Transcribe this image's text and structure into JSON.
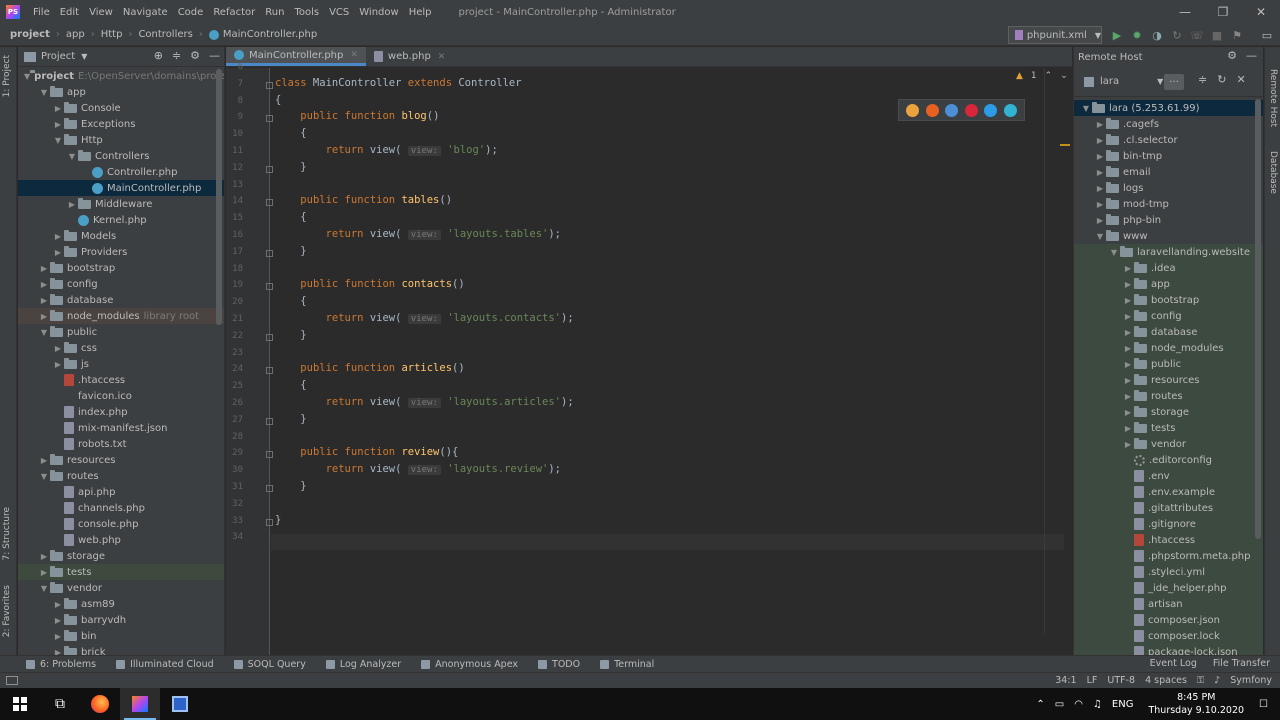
{
  "titlebar": {
    "menu": [
      "File",
      "Edit",
      "View",
      "Navigate",
      "Code",
      "Refactor",
      "Run",
      "Tools",
      "VCS",
      "Window",
      "Help"
    ],
    "window_title": "project - MainController.php - Administrator",
    "logo_text": "PS"
  },
  "navbar": {
    "crumbs": [
      "project",
      "app",
      "Http",
      "Controllers",
      "MainController.php"
    ],
    "run_config": "phpunit.xml"
  },
  "left_stripe": {
    "project_tab": "1: Project",
    "structure_tab": "7: Structure",
    "favorites_tab": "2: Favorites"
  },
  "project_panel": {
    "title": "Project",
    "root_path": "E:\\OpenServer\\domains\\proje",
    "items": [
      {
        "label": "project",
        "indent": 0,
        "type": "folder",
        "open": true,
        "bold": true
      },
      {
        "label": "app",
        "indent": 1,
        "type": "folder",
        "open": true
      },
      {
        "label": "Console",
        "indent": 2,
        "type": "folder",
        "open": false
      },
      {
        "label": "Exceptions",
        "indent": 2,
        "type": "folder",
        "open": false
      },
      {
        "label": "Http",
        "indent": 2,
        "type": "folder",
        "open": true
      },
      {
        "label": "Controllers",
        "indent": 3,
        "type": "folder",
        "open": true
      },
      {
        "label": "Controller.php",
        "indent": 4,
        "type": "php"
      },
      {
        "label": "MainController.php",
        "indent": 4,
        "type": "php",
        "selected": true
      },
      {
        "label": "Middleware",
        "indent": 3,
        "type": "folder",
        "open": false
      },
      {
        "label": "Kernel.php",
        "indent": 3,
        "type": "php"
      },
      {
        "label": "Models",
        "indent": 2,
        "type": "folder",
        "open": false
      },
      {
        "label": "Providers",
        "indent": 2,
        "type": "folder",
        "open": false
      },
      {
        "label": "bootstrap",
        "indent": 1,
        "type": "folder",
        "open": false
      },
      {
        "label": "config",
        "indent": 1,
        "type": "folder",
        "open": false
      },
      {
        "label": "database",
        "indent": 1,
        "type": "folder",
        "open": false
      },
      {
        "label": "node_modules",
        "indent": 1,
        "type": "folder",
        "open": false,
        "libroot": true,
        "note": "library root"
      },
      {
        "label": "public",
        "indent": 1,
        "type": "folder",
        "open": true
      },
      {
        "label": "css",
        "indent": 2,
        "type": "folder",
        "open": false
      },
      {
        "label": "js",
        "indent": 2,
        "type": "folder",
        "open": false
      },
      {
        "label": ".htaccess",
        "indent": 2,
        "type": "ht"
      },
      {
        "label": "favicon.ico",
        "indent": 2,
        "type": "none"
      },
      {
        "label": "index.php",
        "indent": 2,
        "type": "gen"
      },
      {
        "label": "mix-manifest.json",
        "indent": 2,
        "type": "gen"
      },
      {
        "label": "robots.txt",
        "indent": 2,
        "type": "gen"
      },
      {
        "label": "resources",
        "indent": 1,
        "type": "folder",
        "open": false
      },
      {
        "label": "routes",
        "indent": 1,
        "type": "folder",
        "open": true
      },
      {
        "label": "api.php",
        "indent": 2,
        "type": "gen"
      },
      {
        "label": "channels.php",
        "indent": 2,
        "type": "gen"
      },
      {
        "label": "console.php",
        "indent": 2,
        "type": "gen"
      },
      {
        "label": "web.php",
        "indent": 2,
        "type": "gen"
      },
      {
        "label": "storage",
        "indent": 1,
        "type": "folder",
        "open": false
      },
      {
        "label": "tests",
        "indent": 1,
        "type": "folder",
        "open": false,
        "excluded": true
      },
      {
        "label": "vendor",
        "indent": 1,
        "type": "folder",
        "open": true
      },
      {
        "label": "asm89",
        "indent": 2,
        "type": "folder",
        "open": false
      },
      {
        "label": "barryvdh",
        "indent": 2,
        "type": "folder",
        "open": false
      },
      {
        "label": "bin",
        "indent": 2,
        "type": "folder",
        "open": false
      },
      {
        "label": "brick",
        "indent": 2,
        "type": "folder",
        "open": false
      }
    ]
  },
  "editor": {
    "tabs": [
      {
        "label": "MainController.php",
        "active": true
      },
      {
        "label": "web.php",
        "active": false
      }
    ],
    "inspection_count": "1",
    "lines": [
      {
        "n": "6",
        "html": ""
      },
      {
        "n": "7",
        "html": "<span class=\"kw\">class</span> MainController <span class=\"kw\">extends</span> Controller"
      },
      {
        "n": "8",
        "html": "{"
      },
      {
        "n": "9",
        "html": "    <span class=\"kw\">public function</span> <span class=\"fn\">blog</span>()"
      },
      {
        "n": "10",
        "html": "    {"
      },
      {
        "n": "11",
        "html": "        <span class=\"kw\">return</span> view( <span class=\"hint\">view:</span> <span class=\"str\">'blog'</span>);"
      },
      {
        "n": "12",
        "html": "    }"
      },
      {
        "n": "13",
        "html": ""
      },
      {
        "n": "14",
        "html": "    <span class=\"kw\">public function</span> <span class=\"fn\">tables</span>()"
      },
      {
        "n": "15",
        "html": "    {"
      },
      {
        "n": "16",
        "html": "        <span class=\"kw\">return</span> view( <span class=\"hint\">view:</span> <span class=\"str\">'layouts.tables'</span>);"
      },
      {
        "n": "17",
        "html": "    }"
      },
      {
        "n": "18",
        "html": ""
      },
      {
        "n": "19",
        "html": "    <span class=\"kw\">public function</span> <span class=\"fn\">contacts</span>()"
      },
      {
        "n": "20",
        "html": "    {"
      },
      {
        "n": "21",
        "html": "        <span class=\"kw\">return</span> view( <span class=\"hint\">view:</span> <span class=\"str\">'layouts.contacts'</span>);"
      },
      {
        "n": "22",
        "html": "    }"
      },
      {
        "n": "23",
        "html": ""
      },
      {
        "n": "24",
        "html": "    <span class=\"kw\">public function</span> <span class=\"fn\">articles</span>()"
      },
      {
        "n": "25",
        "html": "    {"
      },
      {
        "n": "26",
        "html": "        <span class=\"kw\">return</span> view( <span class=\"hint\">view:</span> <span class=\"str\">'layouts.articles'</span>);"
      },
      {
        "n": "27",
        "html": "    }"
      },
      {
        "n": "28",
        "html": ""
      },
      {
        "n": "29",
        "html": "    <span class=\"kw\">public function</span> <span class=\"fn\">review</span>(){"
      },
      {
        "n": "30",
        "html": "        <span class=\"kw\">return</span> view( <span class=\"hint\">view:</span> <span class=\"str\">'layouts.review'</span>);"
      },
      {
        "n": "31",
        "html": "    }"
      },
      {
        "n": "32",
        "html": ""
      },
      {
        "n": "33",
        "html": "}"
      },
      {
        "n": "34",
        "html": ""
      }
    ],
    "browsers": [
      {
        "name": "chrome-icon",
        "color": "#e8a33d"
      },
      {
        "name": "firefox-icon",
        "color": "#e66020"
      },
      {
        "name": "safari-icon",
        "color": "#4d8fd6"
      },
      {
        "name": "opera-icon",
        "color": "#d8263a"
      },
      {
        "name": "ie-icon",
        "color": "#2d9ce8"
      },
      {
        "name": "edge-icon",
        "color": "#32b3d4"
      }
    ]
  },
  "remote_panel": {
    "title": "Remote Host",
    "server": "lara",
    "dots_label": "...",
    "items": [
      {
        "label": "lara (5.253.61.99)",
        "indent": 0,
        "type": "folder",
        "open": true,
        "selected": true
      },
      {
        "label": ".cagefs",
        "indent": 1,
        "type": "folder",
        "open": false
      },
      {
        "label": ".cl.selector",
        "indent": 1,
        "type": "folder",
        "open": false
      },
      {
        "label": "bin-tmp",
        "indent": 1,
        "type": "folder",
        "open": false
      },
      {
        "label": "email",
        "indent": 1,
        "type": "folder",
        "open": false
      },
      {
        "label": "logs",
        "indent": 1,
        "type": "folder",
        "open": false
      },
      {
        "label": "mod-tmp",
        "indent": 1,
        "type": "folder",
        "open": false
      },
      {
        "label": "php-bin",
        "indent": 1,
        "type": "folder",
        "open": false
      },
      {
        "label": "www",
        "indent": 1,
        "type": "folder",
        "open": true
      },
      {
        "label": "laravellanding.website",
        "indent": 2,
        "type": "folder",
        "open": true,
        "excluded": true
      },
      {
        "label": ".idea",
        "indent": 3,
        "type": "folder",
        "open": false,
        "excluded": true
      },
      {
        "label": "app",
        "indent": 3,
        "type": "folder",
        "open": false,
        "excluded": true
      },
      {
        "label": "bootstrap",
        "indent": 3,
        "type": "folder",
        "open": false,
        "excluded": true
      },
      {
        "label": "config",
        "indent": 3,
        "type": "folder",
        "open": false,
        "excluded": true
      },
      {
        "label": "database",
        "indent": 3,
        "type": "folder",
        "open": false,
        "excluded": true
      },
      {
        "label": "node_modules",
        "indent": 3,
        "type": "folder",
        "open": false,
        "excluded": true
      },
      {
        "label": "public",
        "indent": 3,
        "type": "folder",
        "open": false,
        "excluded": true
      },
      {
        "label": "resources",
        "indent": 3,
        "type": "folder",
        "open": false,
        "excluded": true
      },
      {
        "label": "routes",
        "indent": 3,
        "type": "folder",
        "open": false,
        "excluded": true
      },
      {
        "label": "storage",
        "indent": 3,
        "type": "folder",
        "open": false,
        "excluded": true
      },
      {
        "label": "tests",
        "indent": 3,
        "type": "folder",
        "open": false,
        "excluded": true
      },
      {
        "label": "vendor",
        "indent": 3,
        "type": "folder",
        "open": false,
        "excluded": true
      },
      {
        "label": ".editorconfig",
        "indent": 3,
        "type": "gear",
        "excluded": true
      },
      {
        "label": ".env",
        "indent": 3,
        "type": "gen",
        "excluded": true
      },
      {
        "label": ".env.example",
        "indent": 3,
        "type": "gen",
        "excluded": true
      },
      {
        "label": ".gitattributes",
        "indent": 3,
        "type": "gen",
        "excluded": true
      },
      {
        "label": ".gitignore",
        "indent": 3,
        "type": "gen",
        "excluded": true
      },
      {
        "label": ".htaccess",
        "indent": 3,
        "type": "ht",
        "excluded": true
      },
      {
        "label": ".phpstorm.meta.php",
        "indent": 3,
        "type": "gen",
        "excluded": true
      },
      {
        "label": ".styleci.yml",
        "indent": 3,
        "type": "gen",
        "excluded": true
      },
      {
        "label": "_ide_helper.php",
        "indent": 3,
        "type": "gen",
        "excluded": true
      },
      {
        "label": "artisan",
        "indent": 3,
        "type": "gen",
        "excluded": true
      },
      {
        "label": "composer.json",
        "indent": 3,
        "type": "gen",
        "excluded": true
      },
      {
        "label": "composer.lock",
        "indent": 3,
        "type": "gen",
        "excluded": true
      },
      {
        "label": "package-lock.json",
        "indent": 3,
        "type": "gen",
        "excluded": true
      }
    ]
  },
  "right_stripe": {
    "remote_tab": "Remote Host",
    "database_tab": "Database"
  },
  "bottom_tools": [
    {
      "label": "6: Problems",
      "name": "problems-tool"
    },
    {
      "label": "Illuminated Cloud",
      "name": "illuminated-cloud-tool"
    },
    {
      "label": "SOQL Query",
      "name": "soql-query-tool"
    },
    {
      "label": "Log Analyzer",
      "name": "log-analyzer-tool"
    },
    {
      "label": "Anonymous Apex",
      "name": "anonymous-apex-tool"
    },
    {
      "label": "TODO",
      "name": "todo-tool"
    },
    {
      "label": "Terminal",
      "name": "terminal-tool"
    }
  ],
  "bottom_right_tools": [
    "Event Log",
    "File Transfer"
  ],
  "statusbar": {
    "position": "34:1",
    "line_sep": "LF",
    "encoding": "UTF-8",
    "indent": "4 spaces",
    "framework": "Symfony"
  },
  "taskbar": {
    "lang": "ENG",
    "time": "8:45 PM",
    "date": "Thursday 9.10.2020"
  }
}
